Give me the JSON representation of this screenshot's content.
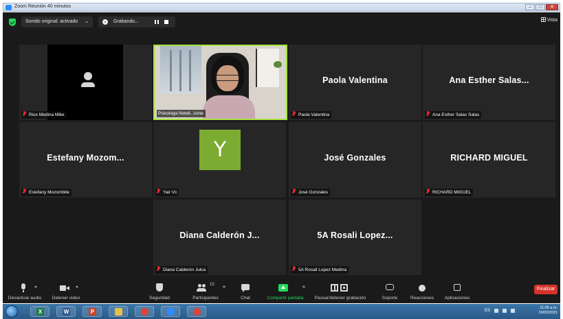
{
  "window": {
    "title": "Zoom Reunión 40 minutos",
    "min": "–",
    "max": "□",
    "close": "✕"
  },
  "topbar": {
    "original_sound": "Sonido original: activado",
    "original_sound_caret": "⌄",
    "recording": "Grabando...",
    "view": "Vista"
  },
  "tiles": [
    {
      "id": "rios",
      "display": "video_off_black",
      "label": "Rios Medina Mike"
    },
    {
      "id": "psico",
      "display": "camera",
      "label": "Psicologa Noteli...isme",
      "active": true
    },
    {
      "id": "paola",
      "display": "name",
      "name": "Paola Valentina",
      "label": "Paola Valentina"
    },
    {
      "id": "ana",
      "display": "name",
      "name": "Ana Esther Salas...",
      "label": "Ana Esther Salas Salas"
    },
    {
      "id": "estefany",
      "display": "name",
      "name": "Estefany Mozom...",
      "label": "Estefany Mozombite"
    },
    {
      "id": "yair",
      "display": "avatar",
      "avatar": "Y",
      "avatar_color": "#7cab32",
      "label": "Yair Vc"
    },
    {
      "id": "jose",
      "display": "name",
      "name": "José Gonzales",
      "label": "José Gonzales"
    },
    {
      "id": "richard",
      "display": "name",
      "name": "RICHARD MIGUEL",
      "label": "RICHARD MIGUEL"
    },
    {
      "id": "diana",
      "display": "name",
      "name": "Diana Calderón J...",
      "label": "Diana Calderón Julca"
    },
    {
      "id": "rosali",
      "display": "name",
      "name": "5A Rosali Lopez...",
      "label": "5A Rosali Lopez Medina"
    }
  ],
  "toolbar": {
    "mute": "Desactivar audio",
    "video": "Detener video",
    "security": "Seguridad",
    "participants": "Participantes",
    "participants_count": "10",
    "chat": "Chat",
    "share": "Compartir pantalla",
    "record": "Pausar/detener grabación",
    "support": "Soporte",
    "reactions": "Reacciones",
    "apps": "Aplicaciones",
    "end": "Finalizar"
  },
  "taskbar": {
    "apps": [
      {
        "name": "excel-icon",
        "letter": "X",
        "color": "#1f7a44"
      },
      {
        "name": "word-icon",
        "letter": "W",
        "color": "#2b5797"
      },
      {
        "name": "powerpoint-icon",
        "letter": "P",
        "color": "#c8432b"
      },
      {
        "name": "folder-icon",
        "letter": "",
        "color": "#e6c14a"
      },
      {
        "name": "chrome-icon",
        "letter": "",
        "color": "#dc4437"
      },
      {
        "name": "zoom-icon",
        "letter": "",
        "color": "#2d8cff"
      },
      {
        "name": "chrome-icon-2",
        "letter": "",
        "color": "#dc4437"
      }
    ],
    "lang": "ES",
    "time": "11:05 a.m.",
    "date": "19/03/2021"
  },
  "colors": {
    "active_border": "#a6e23c",
    "share_green": "#23d959",
    "end_red": "#d6322c",
    "muted_red": "#e02828"
  }
}
